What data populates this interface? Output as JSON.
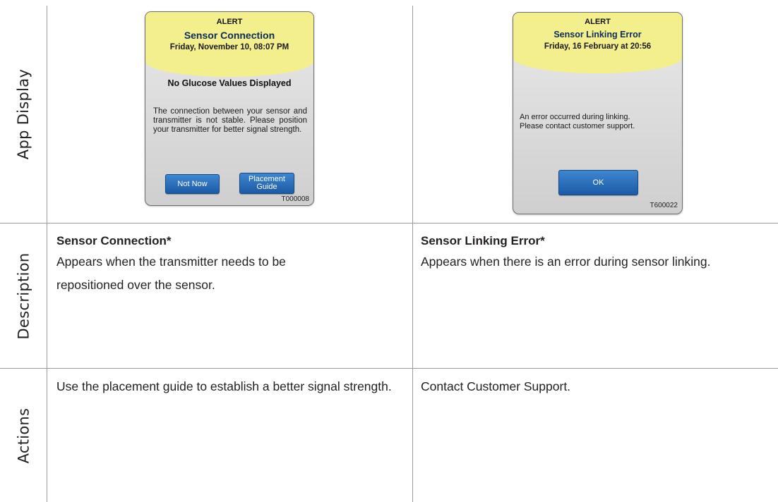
{
  "rows": {
    "app_display": "App Display",
    "description": "Description",
    "actions": "Actions"
  },
  "left": {
    "alert": {
      "header": "ALERT",
      "title": "Sensor Connection",
      "date": "Friday, November 10, 08:07 PM",
      "heading": "No Glucose Values Displayed",
      "message": "The connection between your sensor and transmitter is not stable. Please position your transmitter for better signal strength.",
      "button_primary": "Not Now",
      "button_secondary_line1": "Placement",
      "button_secondary_line2": "Guide",
      "code": "T000008"
    },
    "description_title": "Sensor Connection*",
    "description_text": "Appears when the transmitter needs to be repositioned over the sensor.",
    "actions_text": "Use the placement guide to establish a better signal strength."
  },
  "right": {
    "alert": {
      "header": "ALERT",
      "title": "Sensor Linking Error",
      "date": "Friday, 16 February at 20:56",
      "message_line1": "An error occurred during linking.",
      "message_line2": "Please contact customer support.",
      "button_ok": "OK",
      "code": "T600022"
    },
    "description_title": "Sensor Linking Error*",
    "description_text": "Appears when there is an error during sensor linking.",
    "actions_text": "Contact Customer Support."
  }
}
